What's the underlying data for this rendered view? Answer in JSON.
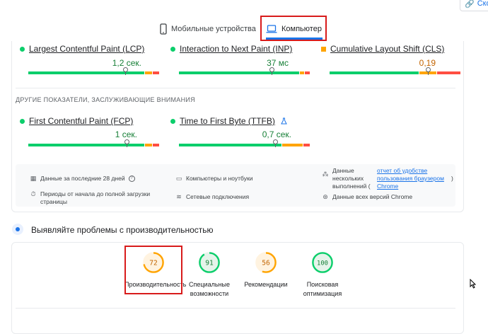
{
  "header": {
    "copy_label": "Ско"
  },
  "tabs": [
    {
      "label": "Мобильные устройства",
      "icon": "smartphone-icon",
      "active": false
    },
    {
      "label": "Компьютер",
      "icon": "laptop-icon",
      "active": true
    }
  ],
  "core_metrics": [
    {
      "name": "Largest Contentful Paint (LCP)",
      "value": "1,2 сек.",
      "status": "good"
    },
    {
      "name": "Interaction to Next Paint (INP)",
      "value": "37 мс",
      "status": "good"
    },
    {
      "name": "Cumulative Layout Shift (CLS)",
      "value": "0,19",
      "status": "needs-improvement"
    }
  ],
  "other_section_title": "ДРУГИЕ ПОКАЗАТЕЛИ, ЗАСЛУЖИВАЮЩИЕ ВНИМАНИЯ",
  "other_metrics": [
    {
      "name": "First Contentful Paint (FCP)",
      "value": "1 сек.",
      "status": "good"
    },
    {
      "name": "Time to First Byte (TTFB)",
      "value": "0,7 сек.",
      "status": "good",
      "badge": "flask-icon"
    }
  ],
  "info": {
    "period": "Данные за последние 28 дней",
    "devices": "Компьютеры и ноутбуки",
    "samples_prefix": "Данные нескольких выполнений (",
    "samples_link": "отчет об удобстве пользования браузером Chrome",
    "samples_suffix": ")",
    "duration": "Периоды от начала до полной загрузки страницы",
    "network": "Сетевые подключения",
    "chrome": "Данные всех версий Chrome"
  },
  "diagnose_title": "Выявляйте проблемы с производительностью",
  "scores": [
    {
      "value": 72,
      "label": "Производительность",
      "color": "#ffa400",
      "track": "#fff3e0",
      "text": "#c26401"
    },
    {
      "value": 91,
      "label": "Специальные возможности",
      "color": "#0cce6b",
      "track": "#e6f4ea",
      "text": "#188038"
    },
    {
      "value": 56,
      "label": "Рекомендации",
      "color": "#ffa400",
      "track": "#fff3e0",
      "text": "#c26401"
    },
    {
      "value": 100,
      "label": "Поисковая оптимизация",
      "color": "#0cce6b",
      "track": "#e6f4ea",
      "text": "#188038"
    }
  ],
  "colors": {
    "good": "#0cce6b",
    "average": "#ffa400",
    "poor": "#ff4e42",
    "accent": "#1a73e8",
    "highlight": "#d81b1b"
  }
}
